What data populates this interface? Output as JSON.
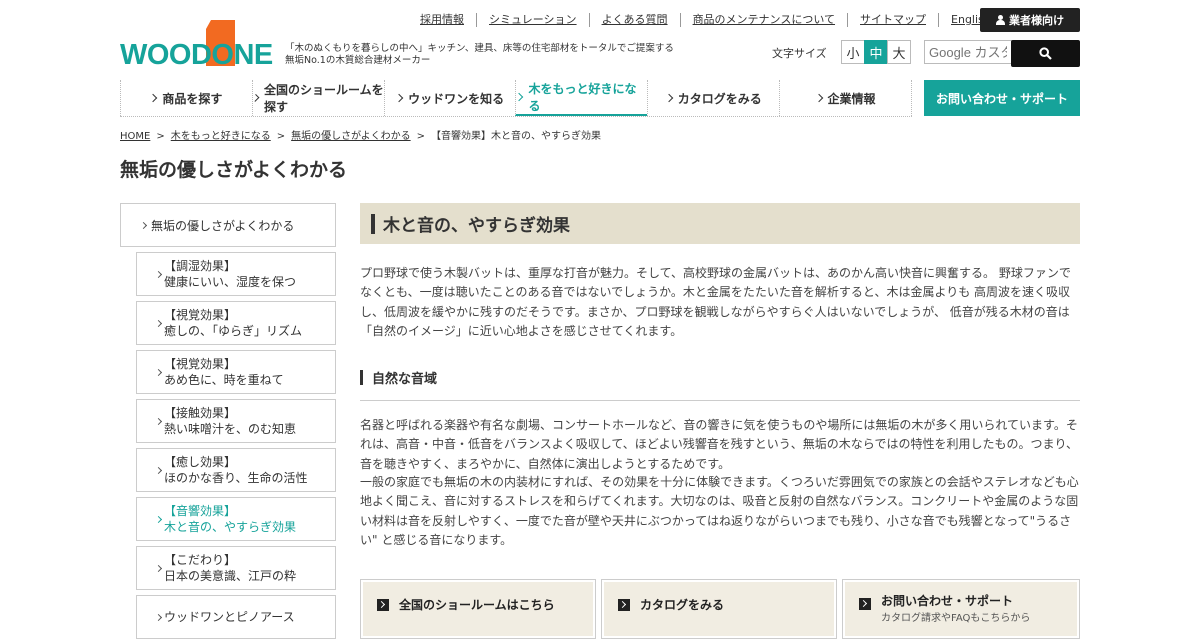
{
  "header": {
    "util_links": [
      "採用情報",
      "シミュレーション",
      "よくある質問",
      "商品のメンテナンスについて",
      "サイトマップ",
      "English"
    ],
    "pro_button": "業者様向け",
    "logo_text": "WOODONE",
    "tagline_1": "「木のぬくもりを暮らしの中へ」キッチン、建具、床等の住宅部材をトータルでご提案する",
    "tagline_2": "無垢No.1の木質総合建材メーカー",
    "font_size_label": "文字サイズ",
    "font_sizes": [
      "小",
      "中",
      "大"
    ],
    "font_size_selected": "中",
    "search_placeholder": "Google カスタム検索",
    "brand_color": "#16a39a",
    "logo_orange": "#f26a21"
  },
  "nav": {
    "items": [
      "商品を探す",
      "全国のショールームを探す",
      "ウッドワンを知る",
      "木をもっと好きになる",
      "カタログをみる",
      "企業情報"
    ],
    "active": "木をもっと好きになる",
    "contact": "お問い合わせ・サポート"
  },
  "breadcrumb": {
    "home": "HOME",
    "level1": "木をもっと好きになる",
    "level2": "無垢の優しさがよくわかる",
    "current": "【音響効果】木と音の、やすらぎ効果",
    "separator": ">"
  },
  "page_title": "無垢の優しさがよくわかる",
  "sidebar": {
    "top": "無垢の優しさがよくわかる",
    "items": [
      {
        "line1": "【調湿効果】",
        "line2": "健康にいい、湿度を保つ"
      },
      {
        "line1": "【視覚効果】",
        "line2": "癒しの、「ゆらぎ」リズム"
      },
      {
        "line1": "【視覚効果】",
        "line2": "あめ色に、時を重ねて"
      },
      {
        "line1": "【接触効果】",
        "line2": "熱い味噌汁を、のむ知恵"
      },
      {
        "line1": "【癒し効果】",
        "line2": "ほのかな香り、生命の活性"
      },
      {
        "line1": "【音響効果】",
        "line2": "木と音の、やすらぎ効果"
      },
      {
        "line1": "【こだわり】",
        "line2": "日本の美意識、江戸の粋"
      },
      {
        "line1": "ウッドワンとピノアース",
        "line2": ""
      }
    ],
    "active_index": 5
  },
  "main": {
    "heading": "木と音の、やすらぎ効果",
    "intro": "プロ野球で使う木製バットは、重厚な打音が魅力。そして、高校野球の金属バットは、あのかん高い快音に興奮する。 野球ファンでなくとも、一度は聴いたことのある音ではないでしょうか。木と金属をたたいた音を解析すると、木は金属よりも 高周波を速く吸収し、低周波を緩やかに残すのだそうです。まさか、プロ野球を観戦しながらやすらぐ人はいないでしょうが、 低音が残る木材の音は「自然のイメージ」に近い心地よさを感じさせてくれます。",
    "subheading": "自然な音域",
    "body_1": "名器と呼ばれる楽器や有名な劇場、コンサートホールなど、音の響きに気を使うものや場所には無垢の木が多く用いられています。それは、高音・中音・低音をバランスよく吸収して、ほどよい残響音を残すという、無垢の木ならではの特性を利用したもの。つまり、 音を聴きやすく、まろやかに、自然体に演出しようとするためです。",
    "body_2": "一般の家庭でも無垢の木の内装材にすれば、その効果を十分に体験できます。くつろいだ雰囲気での家族との会話やステレオなども心地よく聞こえ、音に対するストレスを和らげてくれます。大切なのは、吸音と反射の自然なバランス。コンクリートや金属のような固い材料は音を反射しやすく、一度でた音が壁や天井にぶつかってはね返りながらいつまでも残り、小さな音でも残響となって\"うるさい\" と感じる音になります。"
  },
  "bottom_links": [
    {
      "title": "全国のショールームはこちら",
      "sub": ""
    },
    {
      "title": "カタログをみる",
      "sub": ""
    },
    {
      "title": "お問い合わせ・サポート",
      "sub": "カタログ請求やFAQもこちらから"
    }
  ]
}
